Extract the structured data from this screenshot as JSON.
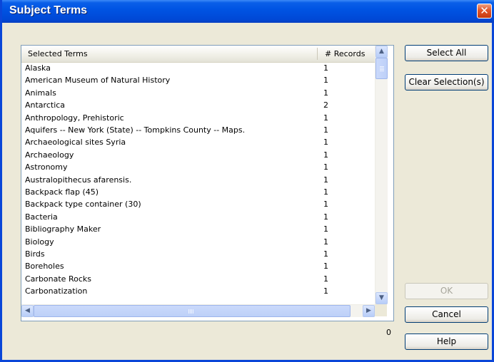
{
  "window": {
    "title": "Subject Terms",
    "close_glyph": "✕"
  },
  "list": {
    "columns": {
      "terms": "Selected Terms",
      "records": "# Records"
    },
    "rows": [
      {
        "term": "Alaska",
        "count": "1"
      },
      {
        "term": "American Museum of Natural History",
        "count": "1"
      },
      {
        "term": "Animals",
        "count": "1"
      },
      {
        "term": "Antarctica",
        "count": "2"
      },
      {
        "term": "Anthropology, Prehistoric",
        "count": "1"
      },
      {
        "term": "Aquifers -- New York (State) -- Tompkins County -- Maps.",
        "count": "1"
      },
      {
        "term": "Archaeological sites Syria",
        "count": "1"
      },
      {
        "term": "Archaeology",
        "count": "1"
      },
      {
        "term": "Astronomy",
        "count": "1"
      },
      {
        "term": "Australopithecus afarensis.",
        "count": "1"
      },
      {
        "term": "Backpack flap (45)",
        "count": "1"
      },
      {
        "term": "Backpack type container (30)",
        "count": "1"
      },
      {
        "term": "Bacteria",
        "count": "1"
      },
      {
        "term": "Bibliography Maker",
        "count": "1"
      },
      {
        "term": "Biology",
        "count": "1"
      },
      {
        "term": "Birds",
        "count": "1"
      },
      {
        "term": "Boreholes",
        "count": "1"
      },
      {
        "term": "Carbonate Rocks",
        "count": "1"
      },
      {
        "term": "Carbonatization",
        "count": "1"
      }
    ],
    "selected_count": "0"
  },
  "scrollbar_glyphs": {
    "up": "▲",
    "down": "▼",
    "left": "◀",
    "right": "▶"
  },
  "buttons": {
    "select_all": "Select All",
    "clear_selection": "Clear Selection(s)",
    "ok": "OK",
    "cancel": "Cancel",
    "help": "Help"
  },
  "colors": {
    "title_bar": "#0054e3",
    "close_button": "#e2552a",
    "dialog_bg": "#ece9d8",
    "list_border": "#7f9db9"
  }
}
